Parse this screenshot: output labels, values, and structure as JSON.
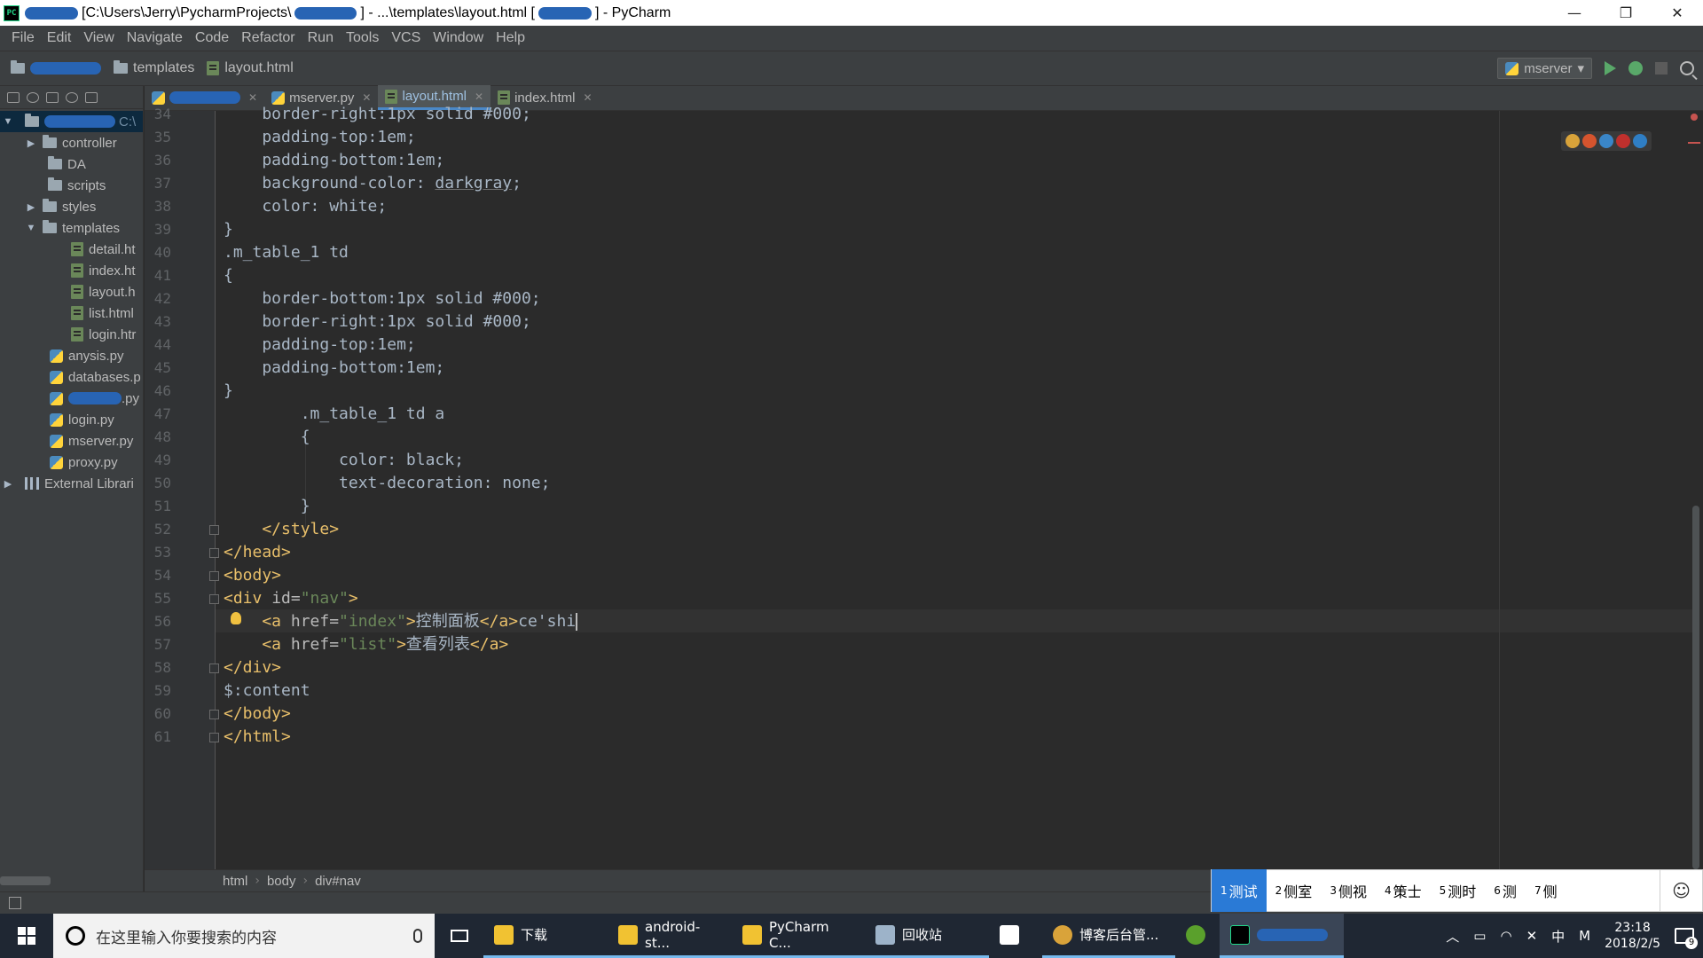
{
  "window": {
    "title_path": "[C:\\Users\\Jerry\\PycharmProjects\\",
    "title_mid": "] - ...\\templates\\layout.html [",
    "title_app": "] - PyCharm",
    "controls": [
      "minimize-icon",
      "restore-icon",
      "close-icon"
    ]
  },
  "menu": [
    "File",
    "Edit",
    "View",
    "Navigate",
    "Code",
    "Refactor",
    "Run",
    "Tools",
    "VCS",
    "Window",
    "Help"
  ],
  "navbar": {
    "crumbs": [
      "templates",
      "layout.html"
    ],
    "run_config": "mserver"
  },
  "project": {
    "root_suffix": "C:\\",
    "items": [
      {
        "label": "controller",
        "type": "folder",
        "arrow": "▶"
      },
      {
        "label": "DA",
        "type": "folder",
        "arrow": ""
      },
      {
        "label": "scripts",
        "type": "folder",
        "arrow": ""
      },
      {
        "label": "styles",
        "type": "folder",
        "arrow": "▶"
      },
      {
        "label": "templates",
        "type": "folder",
        "arrow": "▼"
      },
      {
        "label": "detail.ht",
        "type": "html",
        "arrow": ""
      },
      {
        "label": "index.ht",
        "type": "html",
        "arrow": ""
      },
      {
        "label": "layout.h",
        "type": "html",
        "arrow": ""
      },
      {
        "label": "list.html",
        "type": "html",
        "arrow": ""
      },
      {
        "label": "login.htr",
        "type": "html",
        "arrow": ""
      },
      {
        "label": "anysis.py",
        "type": "py",
        "arrow": ""
      },
      {
        "label": "databases.p",
        "type": "py",
        "arrow": ""
      },
      {
        "label": ".py",
        "type": "py",
        "arrow": ""
      },
      {
        "label": "login.py",
        "type": "py",
        "arrow": ""
      },
      {
        "label": "mserver.py",
        "type": "py",
        "arrow": ""
      },
      {
        "label": "proxy.py",
        "type": "py",
        "arrow": ""
      },
      {
        "label": "External Librari",
        "type": "lib",
        "arrow": "▶"
      }
    ]
  },
  "tabs": [
    {
      "label": "mserver.py",
      "type": "py"
    },
    {
      "label": "layout.html",
      "type": "html",
      "active": true
    },
    {
      "label": "index.html",
      "type": "html"
    }
  ],
  "editor": {
    "line_numbers": [
      "34",
      "35",
      "36",
      "37",
      "38",
      "39",
      "40",
      "41",
      "42",
      "43",
      "44",
      "45",
      "46",
      "47",
      "48",
      "49",
      "50",
      "51",
      "52",
      "53",
      "54",
      "55",
      "56",
      "57",
      "58",
      "59",
      "60",
      "61"
    ],
    "lines": {
      "l34": "    border-right:1px solid #000;",
      "l35": "    padding-top:1em;",
      "l36": "    padding-bottom:1em;",
      "l37a": "    background-color: ",
      "l37b": "darkgray",
      "l37c": ";",
      "l38": "    color: white;",
      "l39": "}",
      "l40": ".m_table_1 td",
      "l41": "{",
      "l42": "    border-bottom:1px solid #000;",
      "l43": "    border-right:1px solid #000;",
      "l44": "    padding-top:1em;",
      "l45": "    padding-bottom:1em;",
      "l46": "}",
      "l47": "        .m_table_1 td a",
      "l48": "        {",
      "l49": "            color: black;",
      "l50": "            text-decoration: none;",
      "l51": "        }",
      "l52": "    </style>",
      "l53": "</head>",
      "l54": "<body>",
      "l55a": "<div ",
      "l55b": "id=",
      "l55c": "\"nav\"",
      "l55d": ">",
      "l56a": "    <a ",
      "l56b": "href=",
      "l56c": "\"index\"",
      "l56d": ">",
      "l56e": "控制面板",
      "l56f": "</a>",
      "l56g": "ce'shi",
      "l57a": "    <a ",
      "l57b": "href=",
      "l57c": "\"list\"",
      "l57d": ">",
      "l57e": "查看列表",
      "l57f": "</a>",
      "l58": "</div>",
      "l59": "$:content",
      "l60": "</body>",
      "l61": "</html>"
    }
  },
  "breadcrumbs": [
    "html",
    "body",
    "div#nav"
  ],
  "ime": {
    "candidates": [
      {
        "idx": "1",
        "text": "测试"
      },
      {
        "idx": "2",
        "text": "侧室"
      },
      {
        "idx": "3",
        "text": "侧视"
      },
      {
        "idx": "4",
        "text": "策士"
      },
      {
        "idx": "5",
        "text": "测时"
      },
      {
        "idx": "6",
        "text": "测"
      },
      {
        "idx": "7",
        "text": "侧"
      }
    ],
    "smile": "☺"
  },
  "taskbar": {
    "search_placeholder": "在这里输入你要搜索的内容",
    "items": [
      "下载",
      "android-st...",
      "PyCharm C...",
      "回收站",
      "博客后台管..."
    ],
    "tray_lang": "中",
    "tray_m": "M",
    "time": "23:18",
    "date": "2018/2/5",
    "notif_count": "9"
  },
  "colors": {
    "accent": "#4a88c7",
    "tag": "#e8bf6a",
    "string": "#6a8759",
    "ime_select": "#2a7ad6"
  }
}
